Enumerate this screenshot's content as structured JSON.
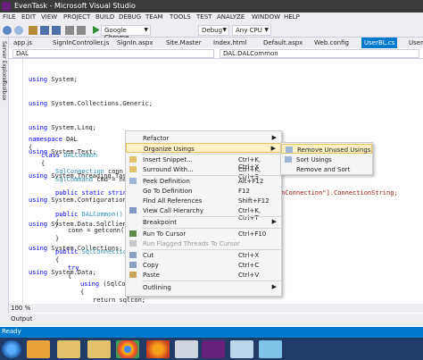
{
  "window": {
    "title": "EvenTask - Microsoft Visual Studio"
  },
  "menu": [
    "FILE",
    "EDIT",
    "VIEW",
    "PROJECT",
    "BUILD",
    "DEBUG",
    "TEAM",
    "TOOLS",
    "TEST",
    "ANALYZE",
    "WINDOW",
    "HELP"
  ],
  "toolbar": {
    "run_target": "Google Chrome",
    "config": "Debug",
    "platform": "Any CPU"
  },
  "tabs": [
    {
      "label": "app.js"
    },
    {
      "label": "SignInController.js"
    },
    {
      "label": "SignIn.aspx"
    },
    {
      "label": "Site.Master"
    },
    {
      "label": "Index.html"
    },
    {
      "label": "Default.aspx"
    },
    {
      "label": "Web.config"
    },
    {
      "label": "UserBL.cs"
    },
    {
      "label": "Users"
    }
  ],
  "side_panels": [
    "Server Explorer",
    "Toolbox"
  ],
  "nav": {
    "left": "DAL",
    "right": "DAL.DALCommon"
  },
  "code": {
    "usings": [
      "System",
      "System.Collections.Generic",
      "System.Linq",
      "System.Text",
      "System.Threading.Tasks",
      "System.Configuration",
      "System.Data.SqlClient",
      "System.Collections",
      "System.Data"
    ],
    "namespace": "DAL",
    "class_name": "DALCommon",
    "field1_type": "SqlConnection",
    "field1_rest": "conn =",
    "field2_type": "SqlCommand",
    "field2_rest": "cmd = new",
    "method_partial": "public static string",
    "conn_string_tail": "nConnection\"].ConnectionString;",
    "ctor": "DALCommon()",
    "ctor_body": "conn = getconn();",
    "method2_type": "SqlConnection",
    "try_kw": "try",
    "using_kw": "using",
    "using_partial": "(SqlCo",
    "return_line": "return sqlcon;"
  },
  "zoom": "100 %",
  "output_label": "Output",
  "status": "Ready",
  "context_menu": [
    {
      "label": "Refactor",
      "shortcut": "",
      "submenu": true
    },
    {
      "label": "Organize Usings",
      "shortcut": "",
      "submenu": true,
      "highlighted": true
    },
    {
      "label": "Insert Snippet...",
      "shortcut": "Ctrl+K, Ctrl+X",
      "icon": "snippet-icon"
    },
    {
      "label": "Surround With...",
      "shortcut": "Ctrl+K, Ctrl+S",
      "icon": "surround-icon"
    },
    {
      "label": "Peek Definition",
      "shortcut": "Alt+F12",
      "icon": "peek-icon"
    },
    {
      "label": "Go To Definition",
      "shortcut": "F12"
    },
    {
      "label": "Find All References",
      "shortcut": "Shift+F12"
    },
    {
      "label": "View Call Hierarchy",
      "shortcut": "Ctrl+K, Ctrl+T",
      "icon": "hierarchy-icon"
    },
    {
      "label": "Breakpoint",
      "shortcut": "",
      "submenu": true
    },
    {
      "label": "Run To Cursor",
      "shortcut": "Ctrl+F10",
      "icon": "run-cursor-icon"
    },
    {
      "label": "Run Flagged Threads To Cursor",
      "shortcut": "",
      "disabled": true,
      "icon": "run-flagged-icon"
    },
    {
      "label": "Cut",
      "shortcut": "Ctrl+X",
      "icon": "cut-icon"
    },
    {
      "label": "Copy",
      "shortcut": "Ctrl+C",
      "icon": "copy-icon"
    },
    {
      "label": "Paste",
      "shortcut": "Ctrl+V",
      "icon": "paste-icon"
    },
    {
      "label": "Outlining",
      "shortcut": "",
      "submenu": true
    }
  ],
  "submenu": [
    {
      "label": "Remove Unused Usings",
      "highlighted": true
    },
    {
      "label": "Sort Usings"
    },
    {
      "label": "Remove and Sort"
    }
  ],
  "taskbar": [
    "start-icon",
    "media-player-icon",
    "file-explorer-icon",
    "chrome-icon",
    "firefox-icon",
    "snipping-tool-icon",
    "visual-studio-icon",
    "notepad-icon",
    "paint-icon"
  ]
}
